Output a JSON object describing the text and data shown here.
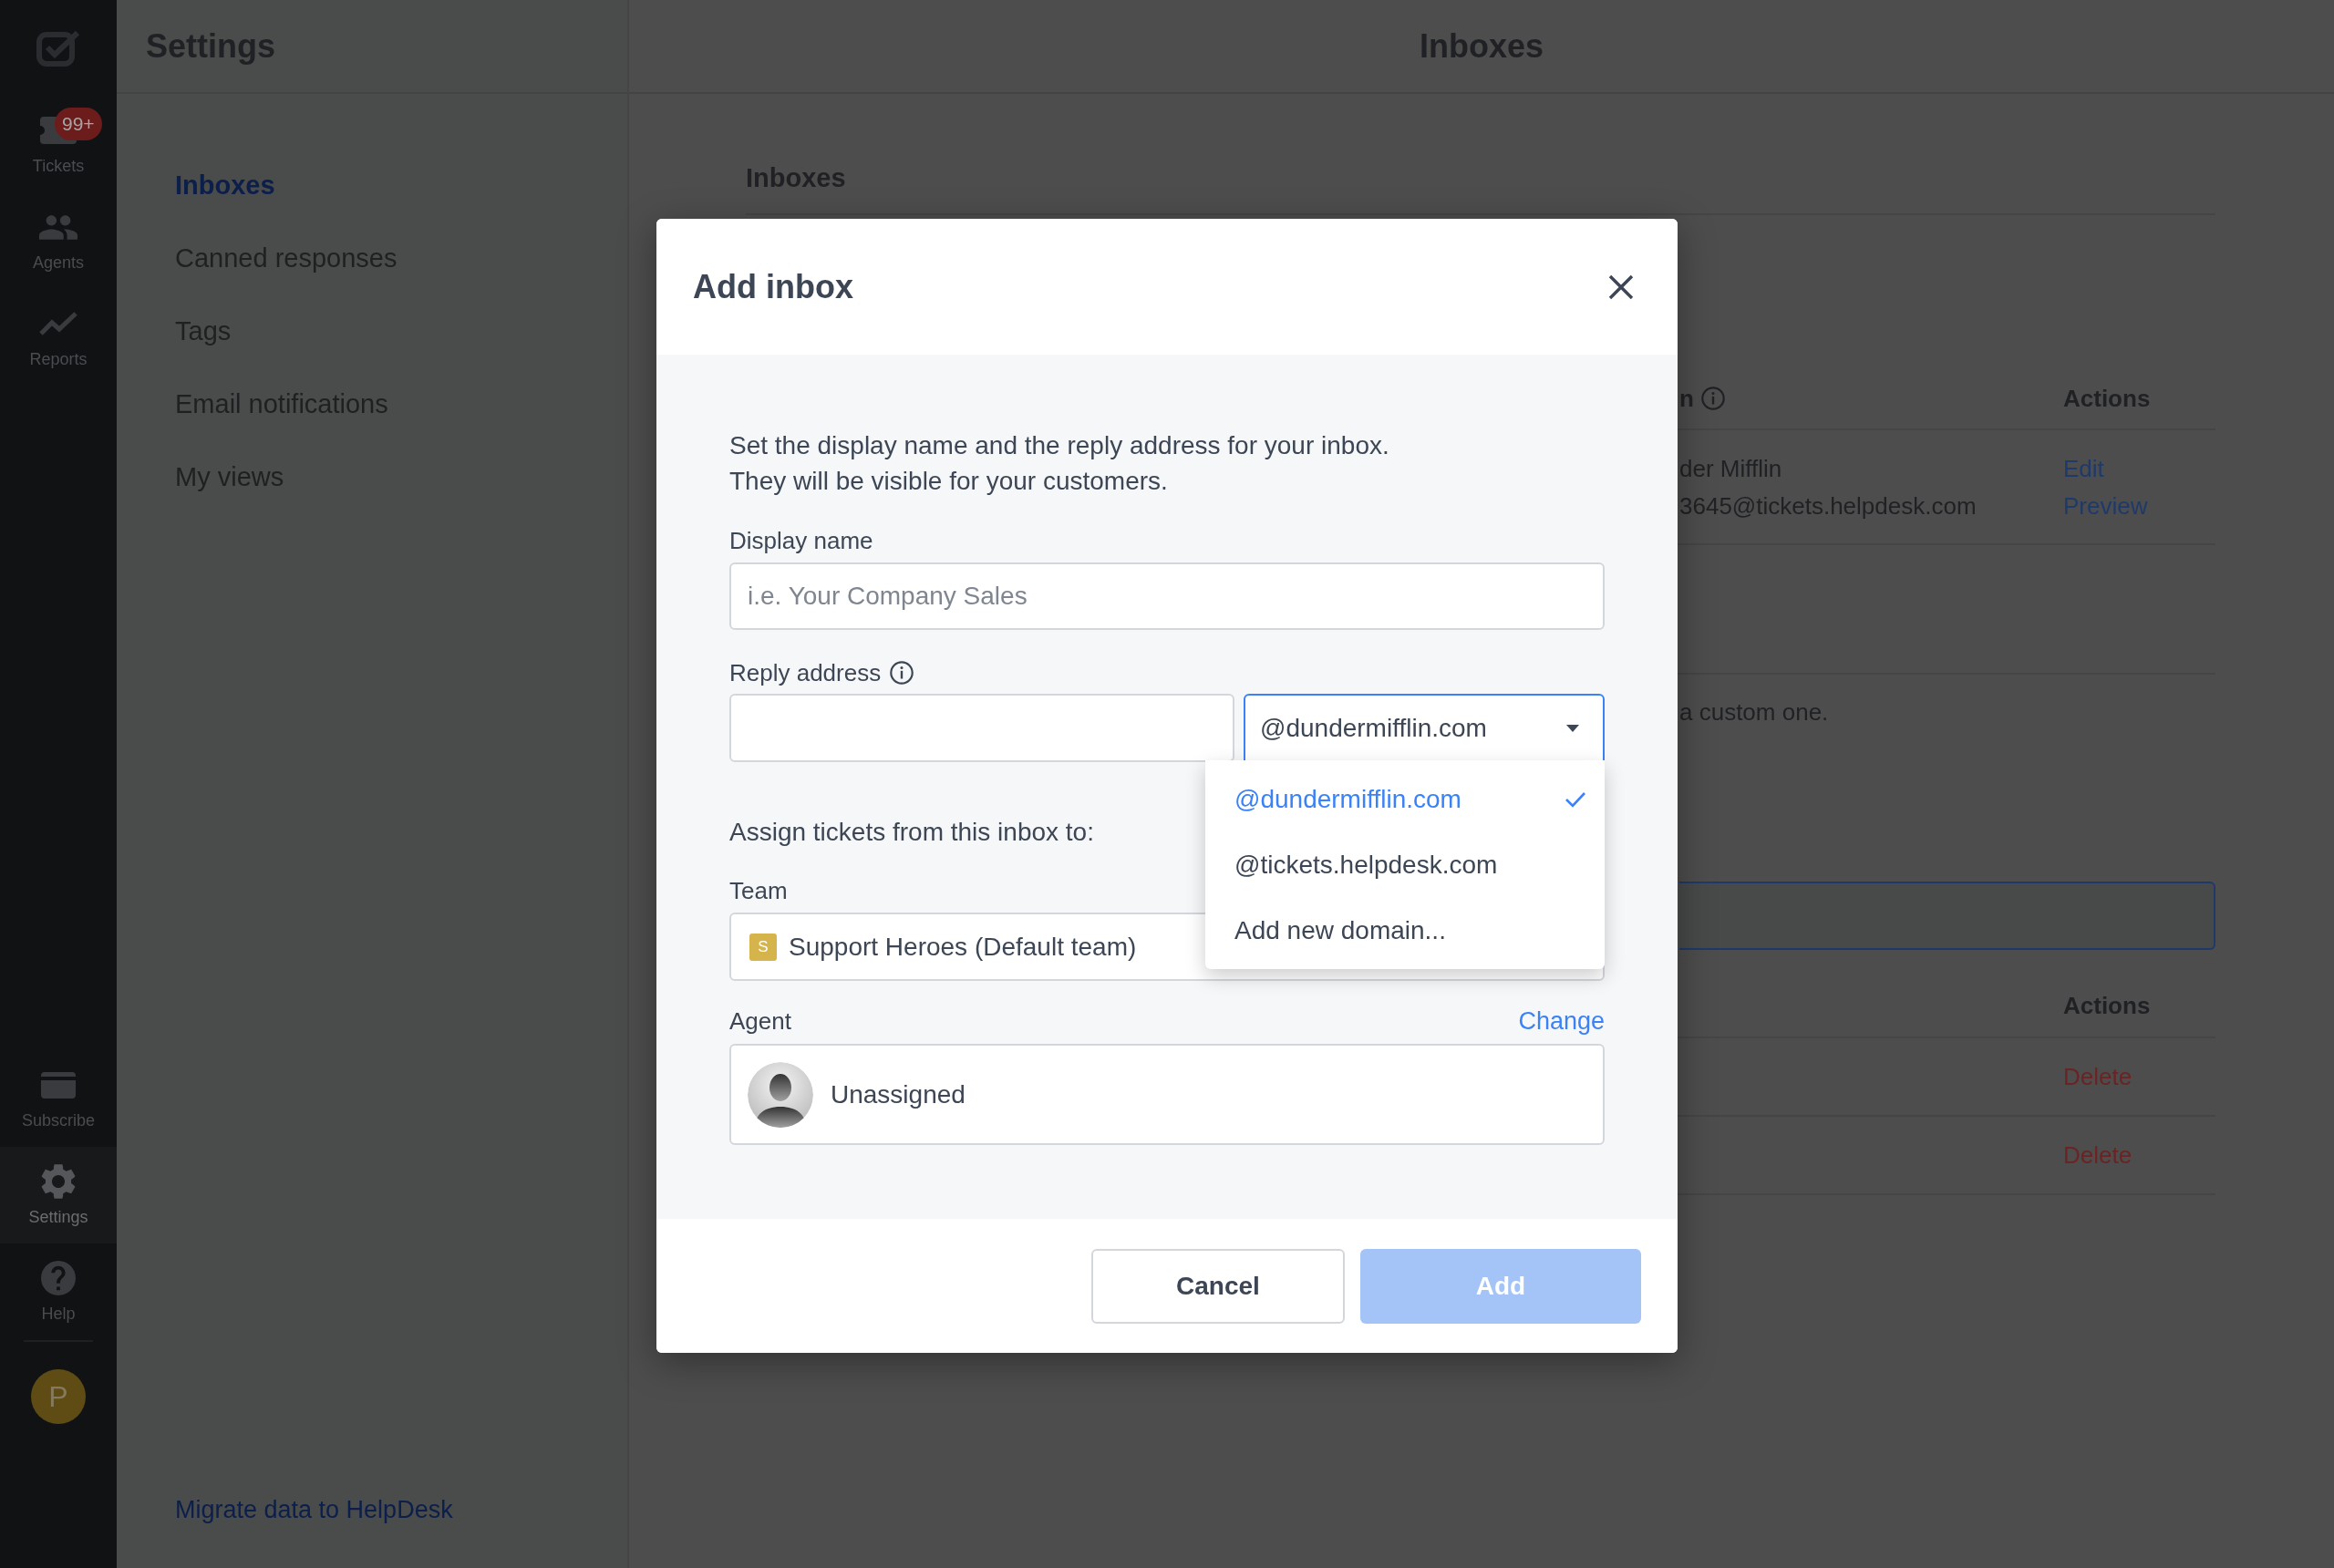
{
  "rail": {
    "items": [
      {
        "label": "Tickets",
        "badge": "99+",
        "selected": false
      },
      {
        "label": "Agents",
        "selected": false
      },
      {
        "label": "Reports",
        "selected": false
      }
    ],
    "bottom_items": [
      {
        "label": "Subscribe",
        "selected": false
      },
      {
        "label": "Settings",
        "selected": true
      },
      {
        "label": "Help",
        "selected": false
      }
    ],
    "avatar": "P"
  },
  "settings_nav": {
    "title": "Settings",
    "items": [
      {
        "label": "Inboxes",
        "selected": true
      },
      {
        "label": "Canned responses",
        "selected": false
      },
      {
        "label": "Tags",
        "selected": false
      },
      {
        "label": "Email notifications",
        "selected": false
      },
      {
        "label": "My views",
        "selected": false
      }
    ],
    "footer_link": "Migrate data to HelpDesk"
  },
  "main": {
    "title": "Inboxes",
    "section_title": "Inboxes",
    "inbox_table": {
      "columns": [
        {
          "label": "n",
          "info": true
        },
        {
          "label": "Actions",
          "info": false
        }
      ],
      "rows": [
        {
          "lines": [
            "der Mifflin",
            "3645@tickets.helpdesk.com"
          ],
          "actions": [
            {
              "label": "Edit",
              "kind": "link"
            },
            {
              "label": "Preview",
              "kind": "link"
            }
          ]
        }
      ]
    },
    "note": "a custom one.",
    "domain_table": {
      "columns": [
        {
          "label": "Actions"
        }
      ],
      "rows": [
        {
          "actions": [
            {
              "label": "Delete",
              "kind": "danger"
            }
          ]
        },
        {
          "actions": [
            {
              "label": "Delete",
              "kind": "danger"
            }
          ]
        }
      ]
    }
  },
  "modal": {
    "title": "Add inbox",
    "intro": "Set the display name and the reply address for your inbox.\nThey will be visible for your customers.",
    "display_name": {
      "label": "Display name",
      "placeholder": "i.e. Your Company Sales"
    },
    "reply_address": {
      "label": "Reply address",
      "info": true,
      "domain": "@dundermifflin.com",
      "expanded": true
    },
    "domain_menu": [
      {
        "label": "@dundermifflin.com",
        "selected": true
      },
      {
        "label": "@tickets.helpdesk.com",
        "selected": false
      },
      {
        "label": "Add new domain...",
        "selected": false
      }
    ],
    "assign_heading": "Assign tickets from this inbox to:",
    "team": {
      "label": "Team",
      "badge": "S",
      "value": "Support Heroes (Default team)"
    },
    "agent": {
      "label": "Agent",
      "link": "Change",
      "value": "Unassigned"
    },
    "buttons": [
      {
        "label": "Cancel",
        "kind": "secondary",
        "disabled": false
      },
      {
        "label": "Add",
        "kind": "primary",
        "disabled": true
      }
    ]
  }
}
